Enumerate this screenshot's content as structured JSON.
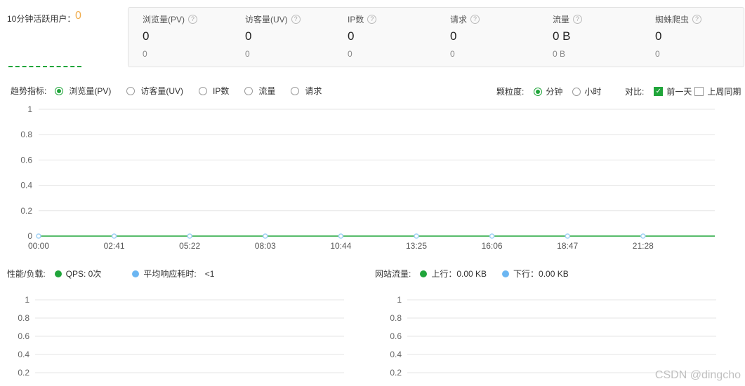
{
  "active": {
    "label": "10分钟活跃用户：",
    "value": "0"
  },
  "stats": [
    {
      "label": "浏览量(PV)",
      "value": "0",
      "sub": "0"
    },
    {
      "label": "访客量(UV)",
      "value": "0",
      "sub": "0"
    },
    {
      "label": "IP数",
      "value": "0",
      "sub": "0"
    },
    {
      "label": "请求",
      "value": "0",
      "sub": "0"
    },
    {
      "label": "流量",
      "value": "0 B",
      "sub": "0 B"
    },
    {
      "label": "蜘蛛爬虫",
      "value": "0",
      "sub": "0"
    }
  ],
  "help_glyph": "?",
  "trend": {
    "label": "趋势指标:",
    "options": [
      "浏览量(PV)",
      "访客量(UV)",
      "IP数",
      "流量",
      "请求"
    ],
    "selected": 0
  },
  "granularity": {
    "label": "颗粒度:",
    "options": [
      "分钟",
      "小时"
    ],
    "selected": 0
  },
  "compare": {
    "label": "对比:",
    "options": [
      {
        "label": "前一天",
        "checked": true
      },
      {
        "label": "上周同期",
        "checked": false
      }
    ],
    "check_glyph": "✓"
  },
  "colors": {
    "accent": "#20a53a",
    "blue": "#6bb6f2",
    "warn": "#f0ad4e"
  },
  "chart_data": [
    {
      "type": "line",
      "x": [
        "00:00",
        "02:41",
        "05:22",
        "08:03",
        "10:44",
        "13:25",
        "16:06",
        "18:47",
        "21:28"
      ],
      "series": [
        {
          "values": [
            0,
            0,
            0,
            0,
            0,
            0,
            0,
            0,
            0
          ]
        }
      ],
      "yticks": [
        "1",
        "0.8",
        "0.6",
        "0.4",
        "0.2",
        "0"
      ],
      "ylim": [
        0,
        1
      ],
      "grid": true
    },
    {
      "type": "line",
      "yticks": [
        "1",
        "0.8",
        "0.6",
        "0.4",
        "0.2"
      ],
      "ylim": [
        0,
        1
      ],
      "grid": true
    },
    {
      "type": "line",
      "yticks": [
        "1",
        "0.8",
        "0.6",
        "0.4",
        "0.2"
      ],
      "ylim": [
        0,
        1
      ],
      "grid": true
    }
  ],
  "perf": {
    "label": "性能/负载:",
    "qps": "QPS: 0次",
    "avg_label": "平均响应耗时:",
    "avg_value": "<1"
  },
  "traffic": {
    "label": "网站流量:",
    "up": "上行：0.00 KB",
    "down": "下行：0.00 KB"
  },
  "watermark": "CSDN @dingcho"
}
